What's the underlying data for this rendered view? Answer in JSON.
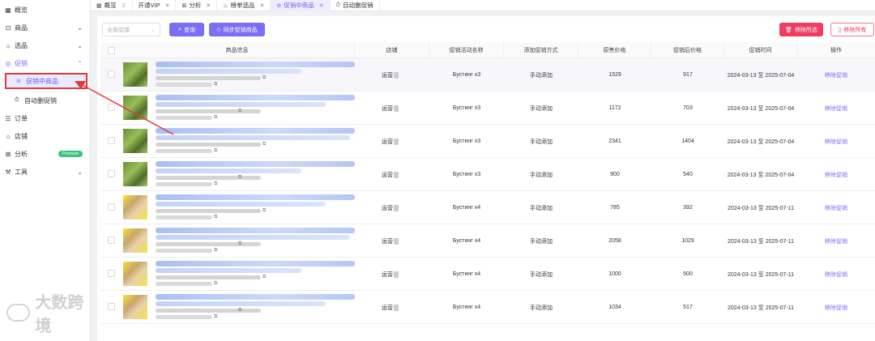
{
  "sidebar": {
    "items": [
      {
        "label": "概览",
        "icon": "grid-icon"
      },
      {
        "label": "商品",
        "icon": "bag-icon",
        "chevron": "down"
      },
      {
        "label": "选品",
        "icon": "sun-icon",
        "chevron": "down"
      },
      {
        "label": "促销",
        "icon": "tag-icon",
        "chevron": "up"
      },
      {
        "label": "订单",
        "icon": "list-icon"
      },
      {
        "label": "店铺",
        "icon": "store-icon"
      },
      {
        "label": "分析",
        "icon": "chart-icon",
        "badge": "Premium"
      },
      {
        "label": "工具",
        "icon": "wrench-icon",
        "chevron": "down"
      }
    ],
    "sub_items": [
      {
        "label": "促销中商品",
        "icon": "link-icon"
      },
      {
        "label": "自动删促销",
        "icon": "clock-icon"
      }
    ],
    "watermark": "大数跨境"
  },
  "tabs": [
    {
      "label": "概览",
      "icon": "grid-icon",
      "closable": false
    },
    {
      "label": "开通VIP",
      "icon": "",
      "closable": true
    },
    {
      "label": "分析",
      "icon": "chart-icon",
      "closable": true
    },
    {
      "label": "榜单选品",
      "icon": "fire-icon",
      "closable": true
    },
    {
      "label": "促销中商品",
      "icon": "link-icon",
      "closable": true,
      "active": true
    },
    {
      "label": "自动删促销",
      "icon": "clock-icon",
      "closable": false
    }
  ],
  "toolbar": {
    "store_placeholder": "全部店铺",
    "query_label": "查询",
    "sync_label": "同步促销商品",
    "remove_selected_label": "移除所选",
    "remove_all_label": "移除所有"
  },
  "colors": {
    "accent": "#7b6ef6",
    "danger": "#f03c5f",
    "annotation": "#e4393c"
  },
  "table": {
    "columns": [
      "商品信息",
      "店铺",
      "促销活动名称",
      "添加促销方式",
      "原售价格",
      "促销后价格",
      "促销时间",
      "操作"
    ],
    "rows": [
      {
        "store": "运营",
        "promo": "Бустинг x3",
        "method": "手动添加",
        "price": "1529",
        "promo_price": "917",
        "time": "2024-03-13 至 2025-07-04",
        "action": "移除促销",
        "thumb": "green"
      },
      {
        "store": "运营",
        "promo": "Бустинг x3",
        "method": "手动添加",
        "price": "1172",
        "promo_price": "703",
        "time": "2024-03-13 至 2025-07-04",
        "action": "移除促销",
        "thumb": "green"
      },
      {
        "store": "运营",
        "promo": "Бустинг x3",
        "method": "手动添加",
        "price": "2341",
        "promo_price": "1404",
        "time": "2024-03-13 至 2025-07-04",
        "action": "移除促销",
        "thumb": "green"
      },
      {
        "store": "运营",
        "promo": "Бустинг x3",
        "method": "手动添加",
        "price": "900",
        "promo_price": "540",
        "time": "2024-03-13 至 2025-07-04",
        "action": "移除促销",
        "thumb": "green"
      },
      {
        "store": "运营",
        "promo": "Бустинг x4",
        "method": "手动添加",
        "price": "785",
        "promo_price": "392",
        "time": "2024-03-13 至 2025-07-11",
        "action": "移除促销",
        "thumb": "yellow"
      },
      {
        "store": "运营",
        "promo": "Бустинг x4",
        "method": "手动添加",
        "price": "2058",
        "promo_price": "1029",
        "time": "2024-03-13 至 2025-07-11",
        "action": "移除促销",
        "thumb": "yellow"
      },
      {
        "store": "运营",
        "promo": "Бустинг x4",
        "method": "手动添加",
        "price": "1000",
        "promo_price": "500",
        "time": "2024-03-13 至 2025-07-11",
        "action": "移除促销",
        "thumb": "yellow"
      },
      {
        "store": "运营",
        "promo": "Бустинг x4",
        "method": "手动添加",
        "price": "1034",
        "promo_price": "517",
        "time": "2024-03-13 至 2025-07-11",
        "action": "移除促销",
        "thumb": "yellow"
      }
    ]
  }
}
